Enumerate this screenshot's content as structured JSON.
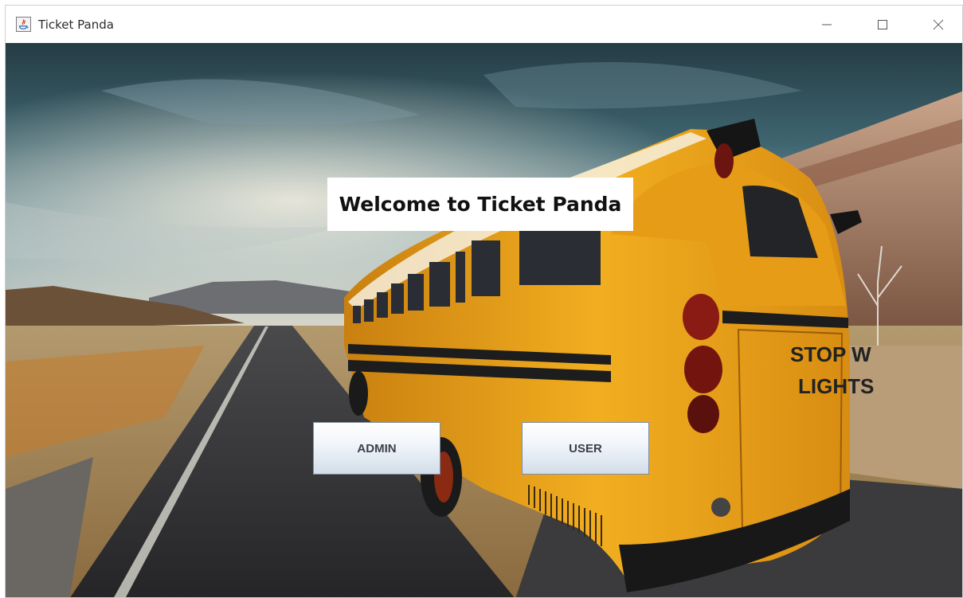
{
  "window": {
    "title": "Ticket Panda",
    "icon": "java-app-icon",
    "controls": [
      "minimize-icon",
      "maximize-icon",
      "close-icon"
    ]
  },
  "main": {
    "welcome_text": "Welcome to Ticket Panda",
    "buttons": {
      "admin_label": "ADMIN",
      "user_label": "USER"
    },
    "background": "school-bus-on-desert-road"
  },
  "colors": {
    "sky_top": "#2f4a52",
    "bus_yellow": "#e8a11a",
    "road": "#3a3a3c"
  }
}
